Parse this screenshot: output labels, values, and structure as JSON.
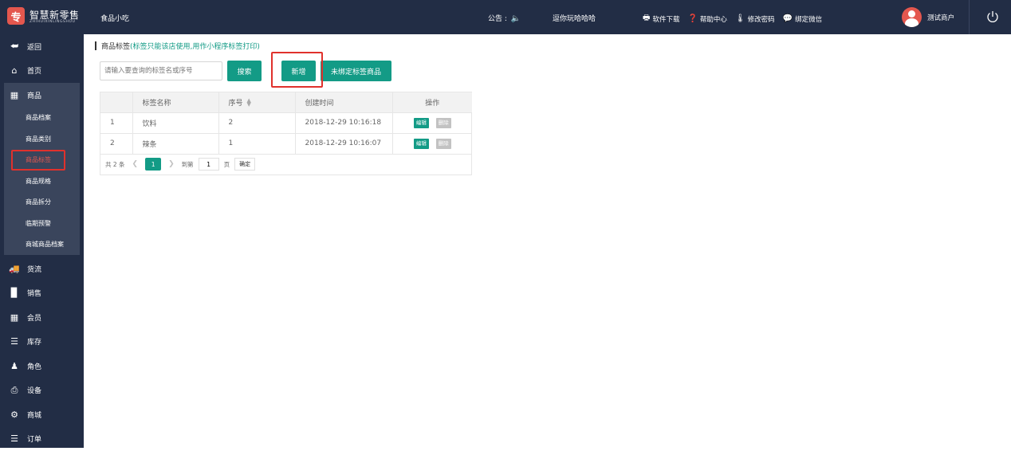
{
  "header": {
    "logo_char": "专",
    "logo_text": "智慧新零售",
    "logo_sub": "ZHIHUIXINLINGSHOU",
    "store_name": "食品小吃",
    "notice_label": "公告 :",
    "notice_text": "逗你玩哈哈哈",
    "links": [
      {
        "icon": "download-icon",
        "label": "软件下载"
      },
      {
        "icon": "help-icon",
        "label": "帮助中心"
      },
      {
        "icon": "password-icon",
        "label": "修改密码"
      },
      {
        "icon": "wechat-icon",
        "label": "绑定微信"
      }
    ],
    "user_name": "测试商户"
  },
  "sidebar": {
    "items": [
      {
        "icon": "back-icon",
        "label": "返回"
      },
      {
        "icon": "home-icon",
        "label": "首页"
      },
      {
        "icon": "grid-icon",
        "label": "商品"
      }
    ],
    "submenu": [
      {
        "label": "商品档案"
      },
      {
        "label": "商品类别"
      },
      {
        "label": "商品标签"
      },
      {
        "label": "商品规格"
      },
      {
        "label": "商品拆分"
      },
      {
        "label": "临期预警"
      },
      {
        "label": "商城商品档案"
      }
    ],
    "items_after": [
      {
        "icon": "truck-icon",
        "label": "货流"
      },
      {
        "icon": "bar-chart-icon",
        "label": "销售"
      },
      {
        "icon": "member-card-icon",
        "label": "会员"
      },
      {
        "icon": "database-icon",
        "label": "库存"
      },
      {
        "icon": "user-icon",
        "label": "角色"
      },
      {
        "icon": "printer-icon",
        "label": "设备"
      },
      {
        "icon": "cog-icon",
        "label": "商城"
      },
      {
        "icon": "list-icon",
        "label": "订单"
      }
    ]
  },
  "main": {
    "title": "商品标签",
    "hint": "(标签只能该店使用,用作小程序标签打印)",
    "search": {
      "placeholder": "请输入要查询的标签名或序号",
      "value": ""
    },
    "buttons": {
      "search": "搜索",
      "add": "新增",
      "unbound": "未绑定标签商品"
    },
    "table": {
      "headers": [
        "",
        "标签名称",
        "序号",
        "创建时间",
        "操作"
      ],
      "rows": [
        {
          "index": "1",
          "name": "饮料",
          "seq": "2",
          "created": "2018-12-29 10:16:18"
        },
        {
          "index": "2",
          "name": "辣条",
          "seq": "1",
          "created": "2018-12-29 10:16:07"
        }
      ],
      "edit_label": "编辑",
      "delete_label": "删除"
    },
    "pager": {
      "total": "共 2 条",
      "current": "1",
      "goto_label": "到第",
      "goto_value": "1",
      "page_label": "页",
      "confirm_label": "确定"
    }
  }
}
